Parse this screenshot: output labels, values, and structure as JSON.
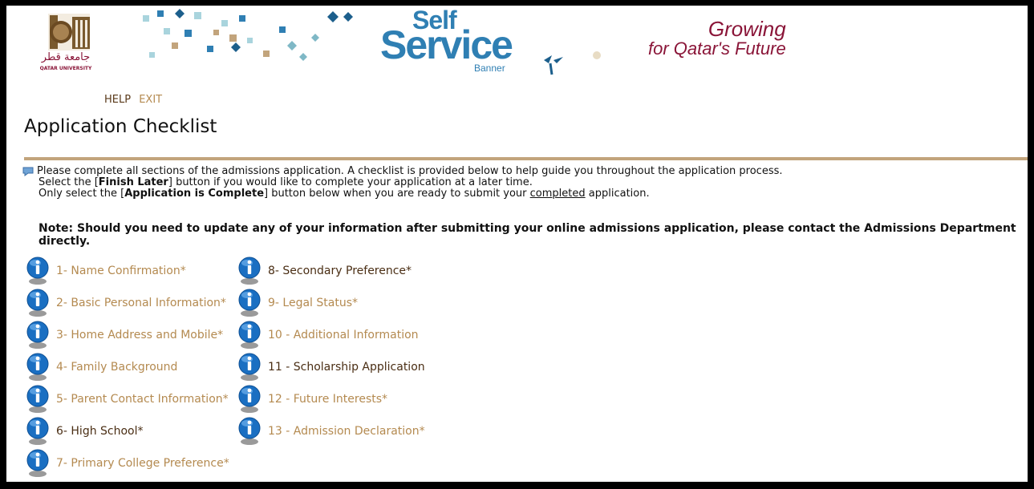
{
  "banner": {
    "logo_arabic": "جامعة قطر",
    "logo_english": "QATAR UNIVERSITY",
    "self": "Self",
    "service": "Service",
    "banner": "Banner",
    "growing": "Growing",
    "tagline": "for Qatar's Future"
  },
  "nav": {
    "help": "HELP",
    "exit": "EXIT"
  },
  "page_title": "Application Checklist",
  "info": {
    "line1": "Please complete all sections of the admissions application. A checklist is provided below to help guide you throughout the application process.",
    "line2_pre": "Select the [",
    "line2_bold": "Finish Later",
    "line2_post": "] button if you would like to complete your application at a later time.",
    "line3_pre": "Only select the [",
    "line3_bold": "Application is Complete",
    "line3_mid": "] button below when you are ready to submit your ",
    "line3_under": "completed",
    "line3_post": " application."
  },
  "note": "Note: Should you need to update any of your information after submitting your online admissions application, please contact the Admissions Department directly.",
  "checklist": {
    "col1": [
      {
        "label": "1- Name Confirmation*",
        "state": "todo"
      },
      {
        "label": "2- Basic Personal Information*",
        "state": "todo"
      },
      {
        "label": "3- Home Address and Mobile*",
        "state": "todo"
      },
      {
        "label": "4- Family Background",
        "state": "todo"
      },
      {
        "label": "5- Parent Contact Information*",
        "state": "todo"
      },
      {
        "label": "6- High School*",
        "state": "done"
      },
      {
        "label": "7- Primary College Preference*",
        "state": "todo"
      }
    ],
    "col2": [
      {
        "label": "8- Secondary Preference*",
        "state": "done"
      },
      {
        "label": "9- Legal Status*",
        "state": "todo"
      },
      {
        "label": "10 - Additional Information",
        "state": "todo"
      },
      {
        "label": "11 - Scholarship Application",
        "state": "done"
      },
      {
        "label": "12 - Future Interests*",
        "state": "todo"
      },
      {
        "label": "13 - Admission Declaration*",
        "state": "todo"
      }
    ]
  },
  "colors": {
    "link_todo": "#b48a50",
    "link_done": "#4a2e14",
    "rule": "#c2a47c",
    "brand_blue": "#2f7fb3",
    "brand_maroon": "#8a1538"
  },
  "icons": {
    "info": "info-icon",
    "note": "note-icon",
    "logo": "qatar-university-logo"
  }
}
